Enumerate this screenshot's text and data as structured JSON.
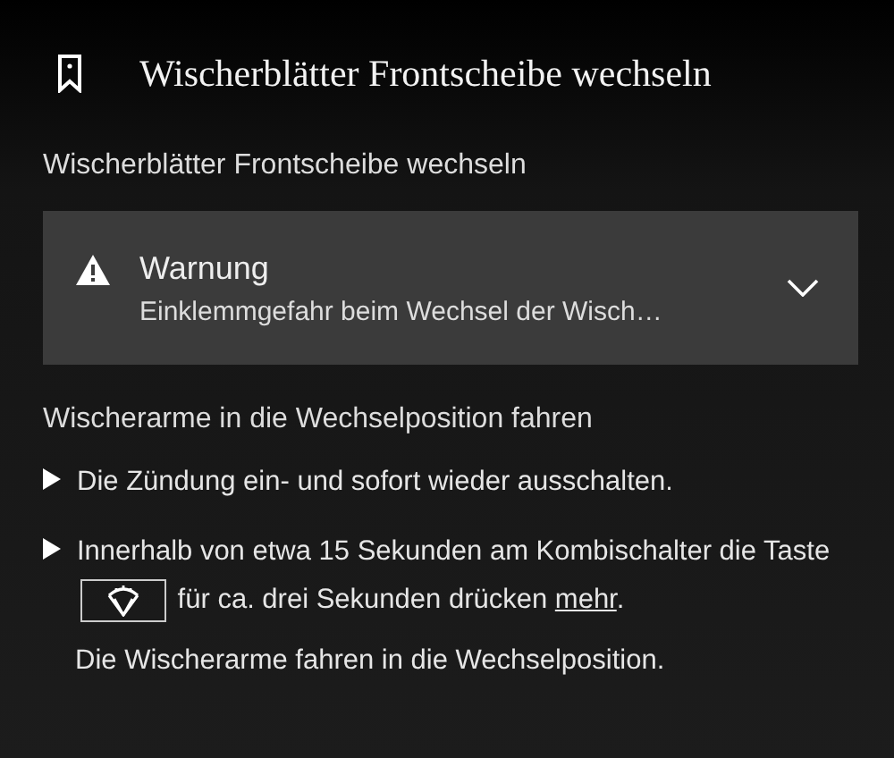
{
  "header": {
    "title": "Wischerblätter Frontscheibe wechseln"
  },
  "section_title": "Wischerblätter Frontscheibe wechseln",
  "warning": {
    "title": "Warnung",
    "text": "Einklemmgefahr beim Wechsel der Wisch…",
    "expanded": false
  },
  "subheading": "Wischerarme in die Wechselposition fahren",
  "steps": [
    {
      "segments": [
        {
          "kind": "text",
          "text": "Die Zündung ein- und sofort wieder ausschalten."
        }
      ]
    },
    {
      "segments": [
        {
          "kind": "text",
          "text": "Innerhalb von etwa 15 Sekunden am Kombischalter die Taste "
        },
        {
          "kind": "key"
        },
        {
          "kind": "text",
          "text": " für ca. drei Sekunden drücken "
        },
        {
          "kind": "link",
          "text": "mehr"
        },
        {
          "kind": "text",
          "text": "."
        }
      ]
    }
  ],
  "result": "Die Wischerarme fahren in die Wechselposition."
}
